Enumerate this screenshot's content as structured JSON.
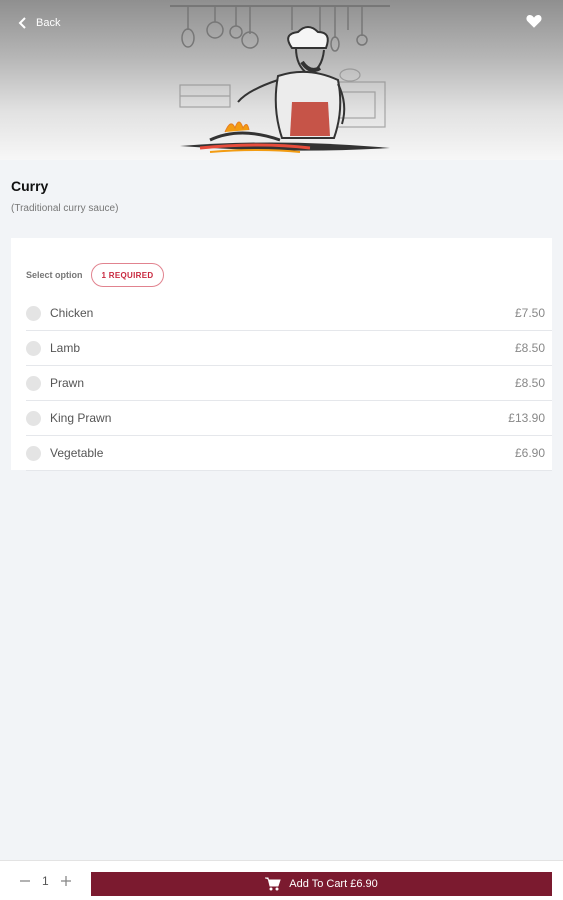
{
  "header": {
    "back_label": "Back",
    "back_icon": "chevron-left-icon",
    "favorite_icon": "heart-icon",
    "hero_image": "chef-cooking-illustration"
  },
  "item": {
    "title": "Curry",
    "description": "(Traditional curry sauce)"
  },
  "options": {
    "select_label": "Select option",
    "required_badge": "1 REQUIRED",
    "items": [
      {
        "name": "Chicken",
        "price": "£7.50"
      },
      {
        "name": "Lamb",
        "price": "£8.50"
      },
      {
        "name": "Prawn",
        "price": "£8.50"
      },
      {
        "name": "King Prawn",
        "price": "£13.90"
      },
      {
        "name": "Vegetable",
        "price": "£6.90"
      }
    ]
  },
  "footer": {
    "quantity": "1",
    "add_to_cart_label": "Add To Cart £6.90",
    "cart_icon": "cart-icon"
  },
  "colors": {
    "accent": "#7b1a2f",
    "required_badge": "#c8283e",
    "background": "#f2f4f7"
  }
}
